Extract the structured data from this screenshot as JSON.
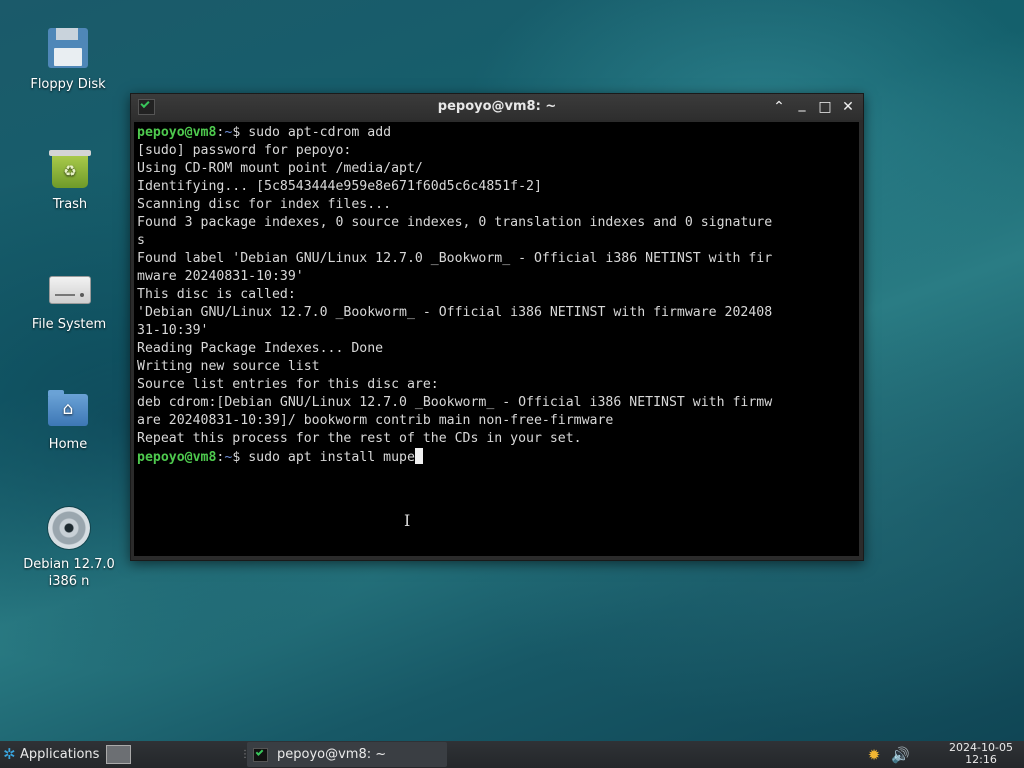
{
  "desktop": {
    "icons": [
      {
        "label": "Floppy Disk",
        "icon": "floppy-disk-icon"
      },
      {
        "label": "Trash",
        "icon": "trash-icon"
      },
      {
        "label": "File System",
        "icon": "hard-drive-icon"
      },
      {
        "label": "Home",
        "icon": "home-folder-icon"
      },
      {
        "label_line1": "Debian 12.7.0",
        "label_line2": "i386 n",
        "icon": "cd-disc-icon"
      }
    ]
  },
  "window": {
    "title": "pepoyo@vm8: ~",
    "controls": {
      "shade": "⌃",
      "minimize": "_",
      "maximize": "□",
      "close": "✕"
    }
  },
  "terminal": {
    "prompt_user": "pepoyo@vm8",
    "prompt_sep": ":",
    "prompt_path": "~",
    "prompt_symbol": "$ ",
    "command1": "sudo apt-cdrom add",
    "output": [
      "[sudo] password for pepoyo:",
      "Using CD-ROM mount point /media/apt/",
      "Identifying... [5c8543444e959e8e671f60d5c6c4851f-2]",
      "Scanning disc for index files...",
      "Found 3 package indexes, 0 source indexes, 0 translation indexes and 0 signature",
      "s",
      "Found label 'Debian GNU/Linux 12.7.0 _Bookworm_ - Official i386 NETINST with fir",
      "mware 20240831-10:39'",
      "This disc is called:",
      "'Debian GNU/Linux 12.7.0 _Bookworm_ - Official i386 NETINST with firmware 202408",
      "31-10:39'",
      "Reading Package Indexes... Done",
      "Writing new source list",
      "Source list entries for this disc are:",
      "deb cdrom:[Debian GNU/Linux 12.7.0 _Bookworm_ - Official i386 NETINST with firmw",
      "are 20240831-10:39]/ bookworm contrib main non-free-firmware",
      "Repeat this process for the rest of the CDs in your set."
    ],
    "command2": "sudo apt install mupe"
  },
  "taskbar": {
    "applications_label": "Applications",
    "task_label": "pepoyo@vm8: ~",
    "clock_date": "2024-10-05",
    "clock_time": "12:16",
    "tray_icons": [
      "updates-icon",
      "volume-icon"
    ]
  },
  "colors": {
    "prompt_user": "#4ec94e",
    "prompt_path": "#6f8fd8",
    "terminal_bg": "#000000",
    "terminal_fg": "#d8d8d8"
  }
}
